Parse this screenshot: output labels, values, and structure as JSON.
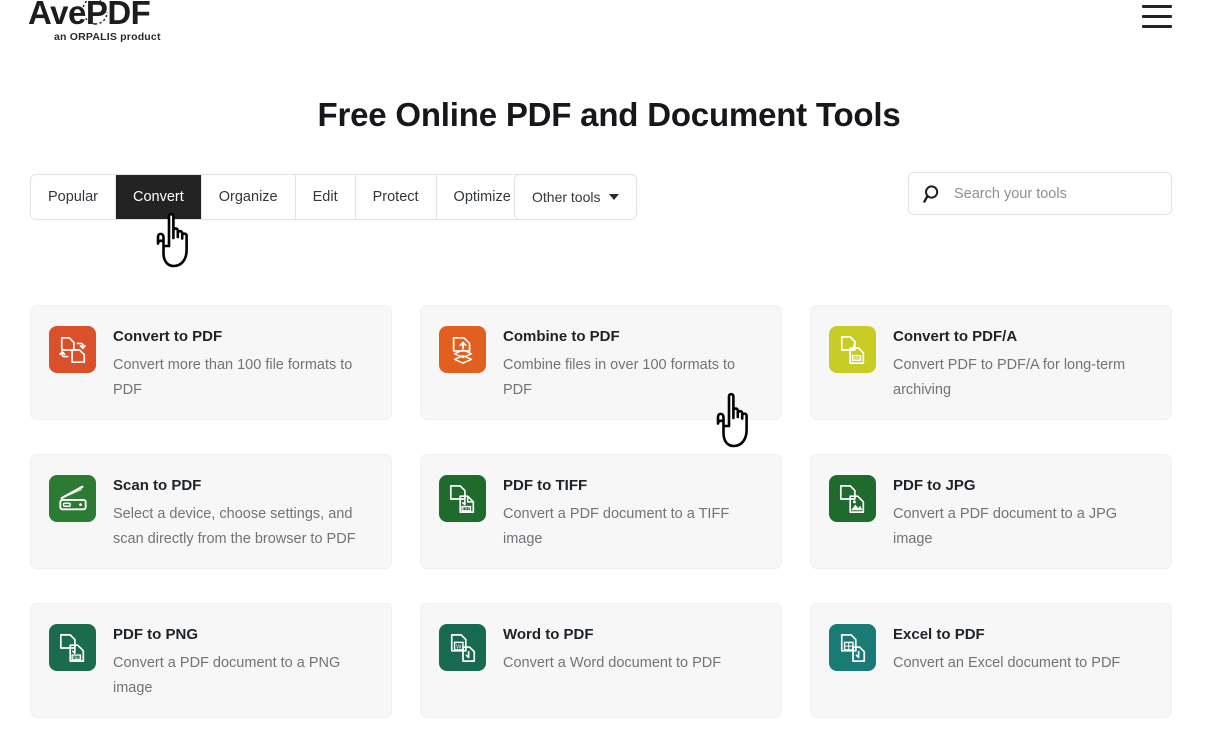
{
  "header": {
    "logo_word": "AvePDF",
    "logo_sub": "an ORPALIS product",
    "menu_icon": "hamburger-menu-icon"
  },
  "page_title": "Free Online PDF and Document Tools",
  "toolbar": {
    "tabs": [
      {
        "label": "Popular",
        "active": false
      },
      {
        "label": "Convert",
        "active": true
      },
      {
        "label": "Organize",
        "active": false
      },
      {
        "label": "Edit",
        "active": false
      },
      {
        "label": "Protect",
        "active": false
      },
      {
        "label": "Optimize",
        "active": false
      }
    ],
    "other_tools_label": "Other tools",
    "other_tools_icon": "chevron-down-icon"
  },
  "search": {
    "placeholder": "Search your tools",
    "value": "",
    "icon": "search-icon"
  },
  "tools": [
    {
      "title": "Convert to PDF",
      "desc": "Convert more than 100 file formats to PDF",
      "icon": "convert-to-pdf-icon",
      "color": "#d9502b"
    },
    {
      "title": "Combine to PDF",
      "desc": "Combine files in over 100 formats to PDF",
      "icon": "combine-to-pdf-icon",
      "color": "#e2601f"
    },
    {
      "title": "Convert to PDF/A",
      "desc": "Convert PDF to PDF/A for long-term archiving",
      "icon": "convert-to-pdfa-icon",
      "color": "#c8cc24"
    },
    {
      "title": "Scan to PDF",
      "desc": "Select a device, choose settings, and scan directly from the browser to PDF",
      "icon": "scanner-icon",
      "color": "#2d7a33"
    },
    {
      "title": "PDF to TIFF",
      "desc": "Convert a PDF document to a TIFF image",
      "icon": "pdf-to-tiff-icon",
      "color": "#1f6b2e"
    },
    {
      "title": "PDF to JPG",
      "desc": "Convert a PDF document to a JPG image",
      "icon": "pdf-to-jpg-icon",
      "color": "#1f6b2e"
    },
    {
      "title": "PDF to PNG",
      "desc": "Convert a PDF document to a PNG image",
      "icon": "pdf-to-png-icon",
      "color": "#1b6b4f"
    },
    {
      "title": "Word to PDF",
      "desc": "Convert a Word document to PDF",
      "icon": "word-to-pdf-icon",
      "color": "#17694f"
    },
    {
      "title": "Excel to PDF",
      "desc": "Convert an Excel document to PDF",
      "icon": "excel-to-pdf-icon",
      "color": "#1a7a75"
    }
  ],
  "cursors": [
    {
      "name": "hand-cursor-over-convert-tab"
    },
    {
      "name": "hand-cursor-over-tool-grid"
    }
  ]
}
